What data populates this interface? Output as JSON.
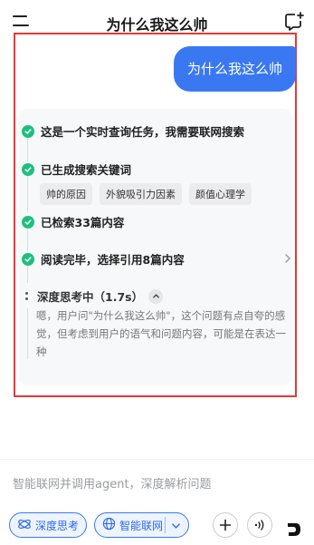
{
  "header": {
    "title": "为什么我这么帅"
  },
  "chat": {
    "user_message": "为什么我这么帅"
  },
  "thinking": {
    "steps": [
      {
        "label": "这是一个实时查询任务，我需要联网搜索"
      },
      {
        "label": "已生成搜索关键词"
      },
      {
        "label": "已检索33篇内容"
      },
      {
        "label": "阅读完毕，选择引用8篇内容"
      }
    ],
    "keywords": [
      "帅的原因",
      "外貌吸引力因素",
      "颜值心理学"
    ],
    "deep_title": "深度思考中（1.7s）",
    "deep_text": "嗯，用户问\"为什么我这么帅\"，这个问题有点自夸的感觉，但考虑到用户的语气和问题内容，可能是在表达一种"
  },
  "composer": {
    "placeholder": "智能联网并调用agent，深度解析问题",
    "deep_think_label": "深度思考",
    "web_search_label": "智能联网"
  },
  "colors": {
    "accent": "#3a78f2",
    "check_green": "#1ec07f",
    "highlight_red": "#e53935"
  }
}
